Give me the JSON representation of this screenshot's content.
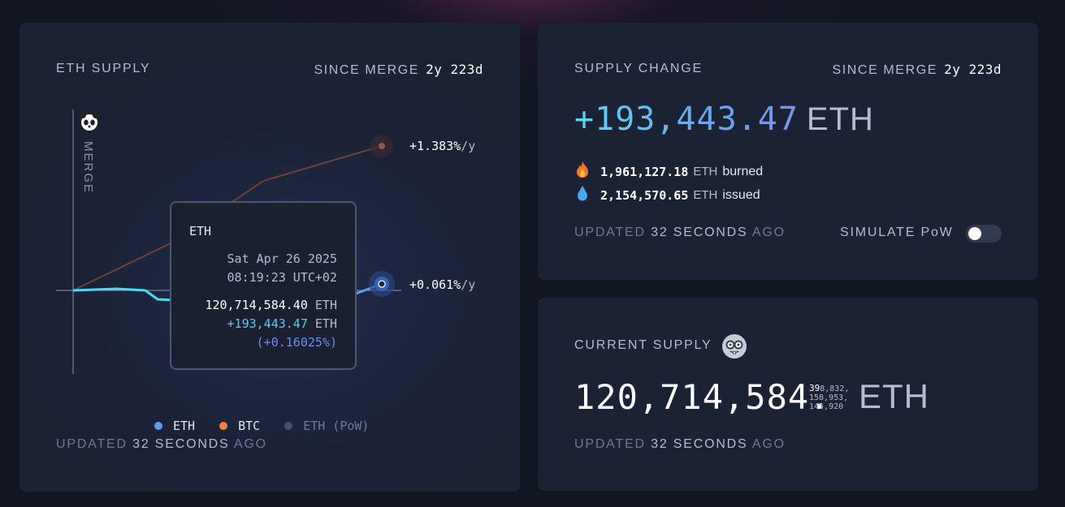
{
  "eth_supply_card": {
    "title": "ETH SUPPLY",
    "since_label": "SINCE MERGE",
    "since_value": "2y 223d",
    "merge_label": "MERGE",
    "btc_rate": "+1.383%",
    "eth_rate": "+0.061%",
    "rate_unit": "/y",
    "tooltip": {
      "title": "ETH",
      "date": "Sat Apr 26 2025",
      "time": "08:19:23 UTC+02",
      "supply": "120,714,584.40",
      "supply_unit": "ETH",
      "change": "+193,443.47",
      "change_unit": "ETH",
      "change_pct": "(+0.16025%)"
    },
    "legend": [
      {
        "label": "ETH",
        "color": "#5b9cf3"
      },
      {
        "label": "BTC",
        "color": "#f0843e"
      },
      {
        "label": "ETH (PoW)",
        "color": "#4a5064"
      }
    ],
    "updated_prefix": "UPDATED",
    "updated_num": "32",
    "updated_unit": "SECONDS",
    "updated_suffix": "AGO"
  },
  "supply_change_card": {
    "title": "SUPPLY CHANGE",
    "since_label": "SINCE MERGE",
    "since_value": "2y 223d",
    "change_value": "+193,443.47",
    "change_unit": "ETH",
    "burned_value": "1,961,127.18",
    "burned_unit": "ETH",
    "burned_word": "burned",
    "issued_value": "2,154,570.65",
    "issued_unit": "ETH",
    "issued_word": "issued",
    "updated_prefix": "UPDATED",
    "updated_num": "32",
    "updated_unit": "SECONDS",
    "updated_suffix": "AGO",
    "simulate_label": "SIMULATE PoW",
    "simulate_on": false,
    "icons": {
      "burned": "fire-icon",
      "issued": "droplet-icon"
    }
  },
  "current_supply_card": {
    "title": "CURRENT SUPPLY",
    "supply_main": "120,714,584.",
    "decimals_line1_hl": "39",
    "decimals_line1": "8,832,",
    "decimals_line2": "158,953,",
    "decimals_line3": "145,920",
    "supply_unit": "ETH",
    "updated_prefix": "UPDATED",
    "updated_num": "32",
    "updated_unit": "SECONDS",
    "updated_suffix": "AGO",
    "icon": "nerd-face-icon"
  },
  "colors": {
    "eth_line": "#4fd8f5",
    "btc_line": "#7a4a40",
    "accent": "#5b9cf3"
  }
}
